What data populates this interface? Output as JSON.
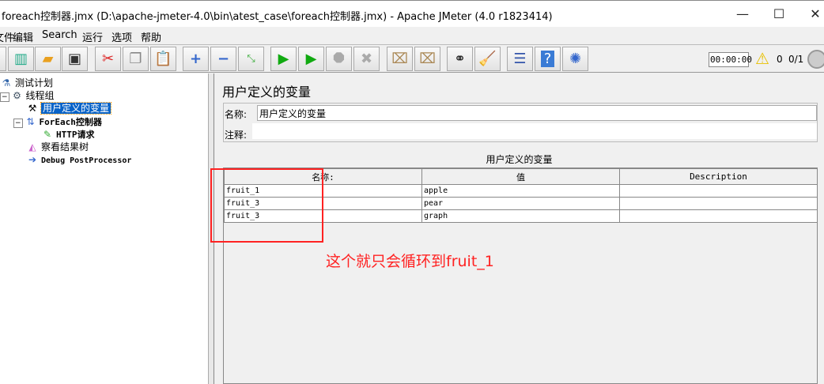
{
  "window": {
    "title": "foreach控制器.jmx (D:\\apache-jmeter-4.0\\bin\\atest_case\\foreach控制器.jmx) - Apache JMeter (4.0 r1823414)",
    "minimize": "—",
    "maximize": "☐",
    "close": "✕"
  },
  "menu": [
    "文件",
    "编辑",
    "Search",
    "运行",
    "选项",
    "帮助"
  ],
  "toolbar": {
    "icons": [
      "new-icon",
      "templates-icon",
      "open-icon",
      "save-icon",
      "cut-icon",
      "copy-icon",
      "paste-icon",
      "expand-icon",
      "collapse-icon",
      "toggle-icon",
      "start-icon",
      "start-no-pauses-icon",
      "stop-icon",
      "shutdown-icon",
      "clear-icon",
      "clear-all-icon",
      "search-icon",
      "reset-search-icon",
      "function-helper-icon",
      "help-icon",
      "remote-icon"
    ],
    "timer": "00:00:00",
    "warnings": "0",
    "threads": "0/1"
  },
  "tree": [
    {
      "label": "测试计划",
      "icon": "test-plan-icon"
    },
    {
      "label": "线程组",
      "icon": "thread-group-icon"
    },
    {
      "label": "用户定义的变量",
      "icon": "config-icon"
    },
    {
      "label": "ForEach控制器",
      "icon": "controller-icon"
    },
    {
      "label": "HTTP请求",
      "icon": "sampler-icon"
    },
    {
      "label": "察看结果树",
      "icon": "listener-icon"
    },
    {
      "label": "Debug PostProcessor",
      "icon": "postprocessor-icon"
    }
  ],
  "panel": {
    "title": "用户定义的变量",
    "name_label": "名称:",
    "name_value": "用户定义的变量",
    "comment_label": "注释:",
    "comment_value": "",
    "table_title": "用户定义的变量",
    "columns": [
      "名称:",
      "值",
      "Description"
    ],
    "rows": [
      [
        "fruit_1",
        "apple",
        ""
      ],
      [
        "fruit_3",
        "pear",
        ""
      ],
      [
        "fruit_3",
        "graph",
        ""
      ]
    ]
  },
  "annotation": "这个就只会循环到fruit_1",
  "colors": {
    "annotation": "#ff2222",
    "selection": "#0a64c8"
  }
}
